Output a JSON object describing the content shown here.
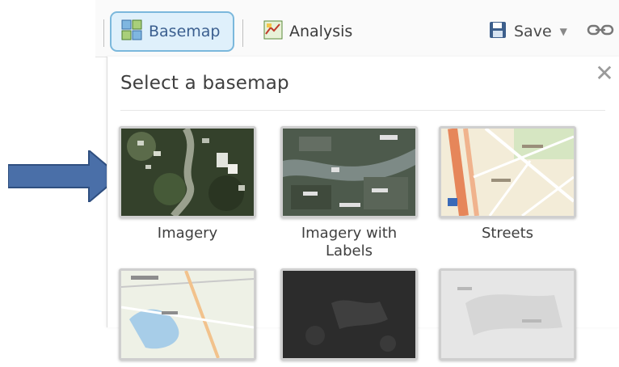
{
  "toolbar": {
    "basemap_label": "Basemap",
    "analysis_label": "Analysis",
    "save_label": "Save"
  },
  "panel": {
    "title": "Select a basemap",
    "tiles": [
      {
        "label": "Imagery"
      },
      {
        "label": "Imagery with Labels"
      },
      {
        "label": "Streets"
      },
      {
        "label": ""
      },
      {
        "label": ""
      },
      {
        "label": ""
      }
    ]
  },
  "colors": {
    "arrow": "#4a6fa8",
    "basemap_bg": "#dff0fb",
    "basemap_border": "#7bb8dc"
  }
}
